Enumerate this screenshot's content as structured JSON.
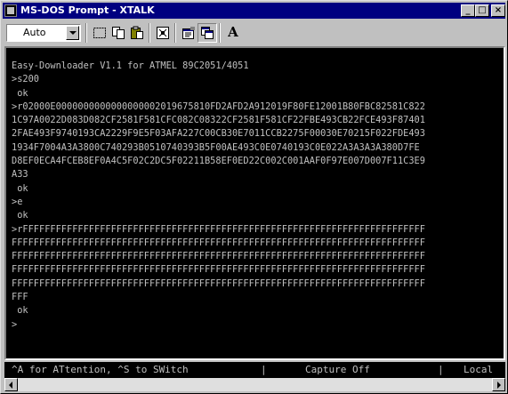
{
  "window": {
    "title": "MS-DOS Prompt - XTALK",
    "minimize_glyph": "_",
    "maximize_glyph": "□",
    "close_glyph": "×"
  },
  "toolbar": {
    "font_size_value": "Auto",
    "font_button_label": "A",
    "icons": [
      "mark-icon",
      "copy-icon",
      "paste-icon",
      "fullscreen-icon",
      "properties-icon",
      "background-icon",
      "font-icon"
    ]
  },
  "terminal": {
    "foreground": "#c0c0c0",
    "background": "#000000",
    "lines": [
      "Easy-Downloader V1.1 for ATMEL 89C2051/4051",
      ">s200",
      " ok",
      ">r02000E0000000000000000002019675810FD2AFD2A912019F80FE12001B80FBC82581C822",
      "1C97A0022D083D082CF2581F581CFC082C08322CF2581F581CF22FBE493CB22FCE493F87401",
      "2FAE493F9740193CA2229F9E5F03AFA227C00CB30E7011CCB2275F00030E70215F022FDE493",
      "1934F7004A3A3800C740293B0510740393B5F00AE493C0E0740193C0E022A3A3A3A380D7FE",
      "D8EF0ECA4FCEB8EF0A4C5F02C2DC5F02211B58EF0ED22C002C001AAF0F97E007D007F11C3E9",
      "A33",
      " ok",
      ">e",
      " ok",
      ">rFFFFFFFFFFFFFFFFFFFFFFFFFFFFFFFFFFFFFFFFFFFFFFFFFFFFFFFFFFFFFFFFFFFFFFFFF",
      "FFFFFFFFFFFFFFFFFFFFFFFFFFFFFFFFFFFFFFFFFFFFFFFFFFFFFFFFFFFFFFFFFFFFFFFFFFF",
      "FFFFFFFFFFFFFFFFFFFFFFFFFFFFFFFFFFFFFFFFFFFFFFFFFFFFFFFFFFFFFFFFFFFFFFFFFFF",
      "FFFFFFFFFFFFFFFFFFFFFFFFFFFFFFFFFFFFFFFFFFFFFFFFFFFFFFFFFFFFFFFFFFFFFFFFFFF",
      "FFFFFFFFFFFFFFFFFFFFFFFFFFFFFFFFFFFFFFFFFFFFFFFFFFFFFFFFFFFFFFFFFFFFFFFFFFF",
      "FFF",
      " ok",
      ">"
    ]
  },
  "status_bar": {
    "hint": "^A for ATtention, ^S to SWitch",
    "separator": "|",
    "capture": "Capture Off",
    "mode": "Local"
  }
}
